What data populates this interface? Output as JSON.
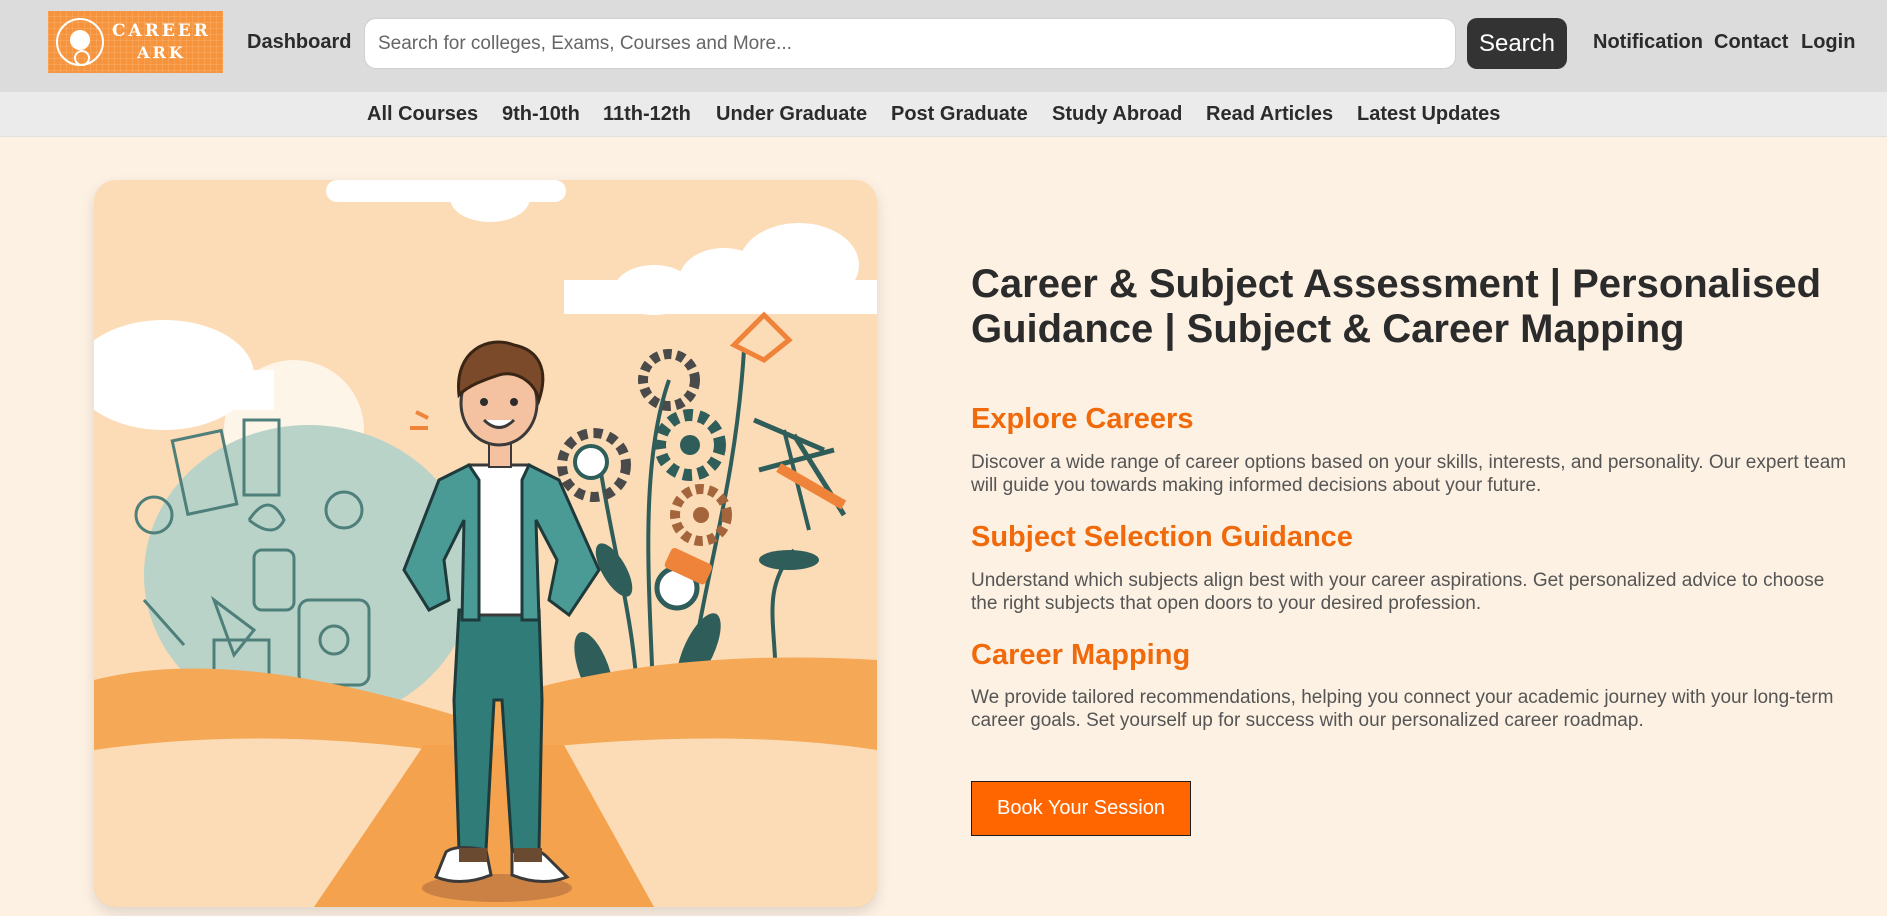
{
  "header": {
    "logo": {
      "line1": "CAREER",
      "line2": "ARK"
    },
    "dashboard_label": "Dashboard",
    "search": {
      "placeholder": "Search for colleges, Exams, Courses and More...",
      "value": "",
      "button_label": "Search"
    },
    "notification_label": "Notification",
    "contact_label": "Contact",
    "login_label": "Login"
  },
  "subnav": {
    "items": [
      {
        "label": "All Courses"
      },
      {
        "label": "9th-10th"
      },
      {
        "label": "11th-12th"
      },
      {
        "label": "Under Graduate"
      },
      {
        "label": "Post Graduate"
      },
      {
        "label": "Study Abroad"
      },
      {
        "label": "Read Articles"
      },
      {
        "label": "Latest Updates"
      }
    ]
  },
  "hero": {
    "headline": "Career & Subject Assessment | Personalised Guidance | Subject & Career Mapping",
    "sections": [
      {
        "title": "Explore Careers",
        "text": "Discover a wide range of career options based on your skills, interests, and personality. Our expert team will guide you towards making informed decisions about your future."
      },
      {
        "title": "Subject Selection Guidance",
        "text": "Understand which subjects align best with your career aspirations. Get personalized advice to choose the right subjects that open doors to your desired profession."
      },
      {
        "title": "Career Mapping",
        "text": "We provide tailored recommendations, helping you connect your academic journey with your long-term career goals. Set yourself up for success with our personalized career roadmap."
      }
    ],
    "cta_label": "Book Your Session"
  },
  "colors": {
    "accent": "#ff6600",
    "heading_accent": "#f06a0c",
    "header_bg": "#dcdcdc",
    "page_bg": "#fdf1e3"
  }
}
